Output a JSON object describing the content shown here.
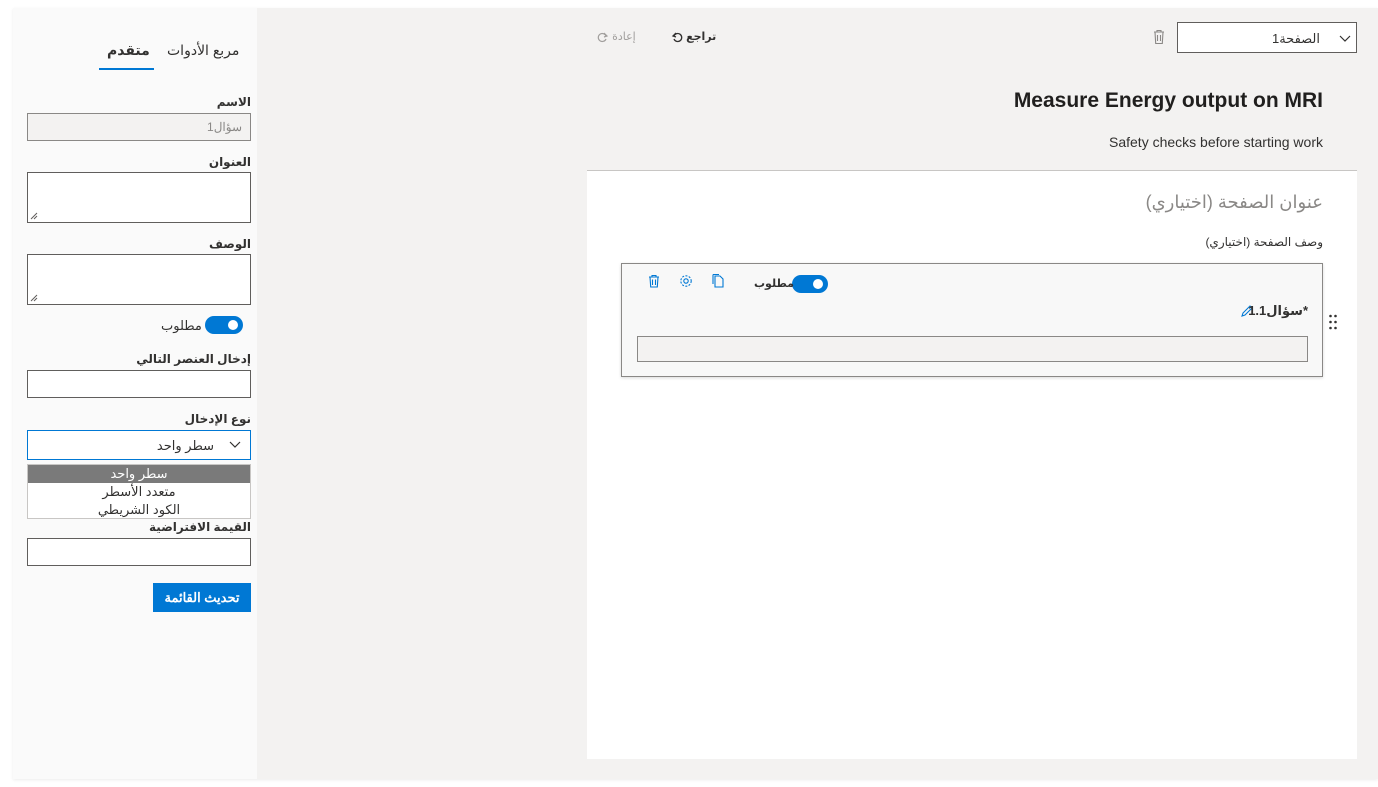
{
  "left_panel": {
    "tabs": [
      {
        "label": "مربع الأدوات"
      },
      {
        "label": "متقدم"
      }
    ],
    "fields": {
      "name_label": "الاسم",
      "name_value": "سؤال1",
      "title_label": "العنوان",
      "description_label": "الوصف",
      "required_label": "مطلوب",
      "next_item_label": "إدخال العنصر التالي",
      "input_type_label": "نوع الإدخال",
      "input_type_selected": "سطر واحد",
      "input_type_options": [
        "سطر واحد",
        "متعدد الأسطر",
        "الكود الشريطي"
      ],
      "default_value_label": "القيمة الافتراضية"
    },
    "update_button": "تحديث القائمة"
  },
  "top_bar": {
    "page_select_value": "الصفحة1",
    "undo_label": "تراجع",
    "redo_label": "إعادة"
  },
  "form": {
    "title": "Measure Energy output on MRI",
    "subtitle": "Safety checks before starting work",
    "page_title_placeholder": "عنوان الصفحة (اختياري)",
    "page_description_placeholder": "وصف الصفحة (اختياري)",
    "question": {
      "required_label": "مطلوب",
      "title": "1.سؤال1*"
    }
  },
  "colors": {
    "accent": "#0078d4",
    "background": "#f3f2f1"
  }
}
